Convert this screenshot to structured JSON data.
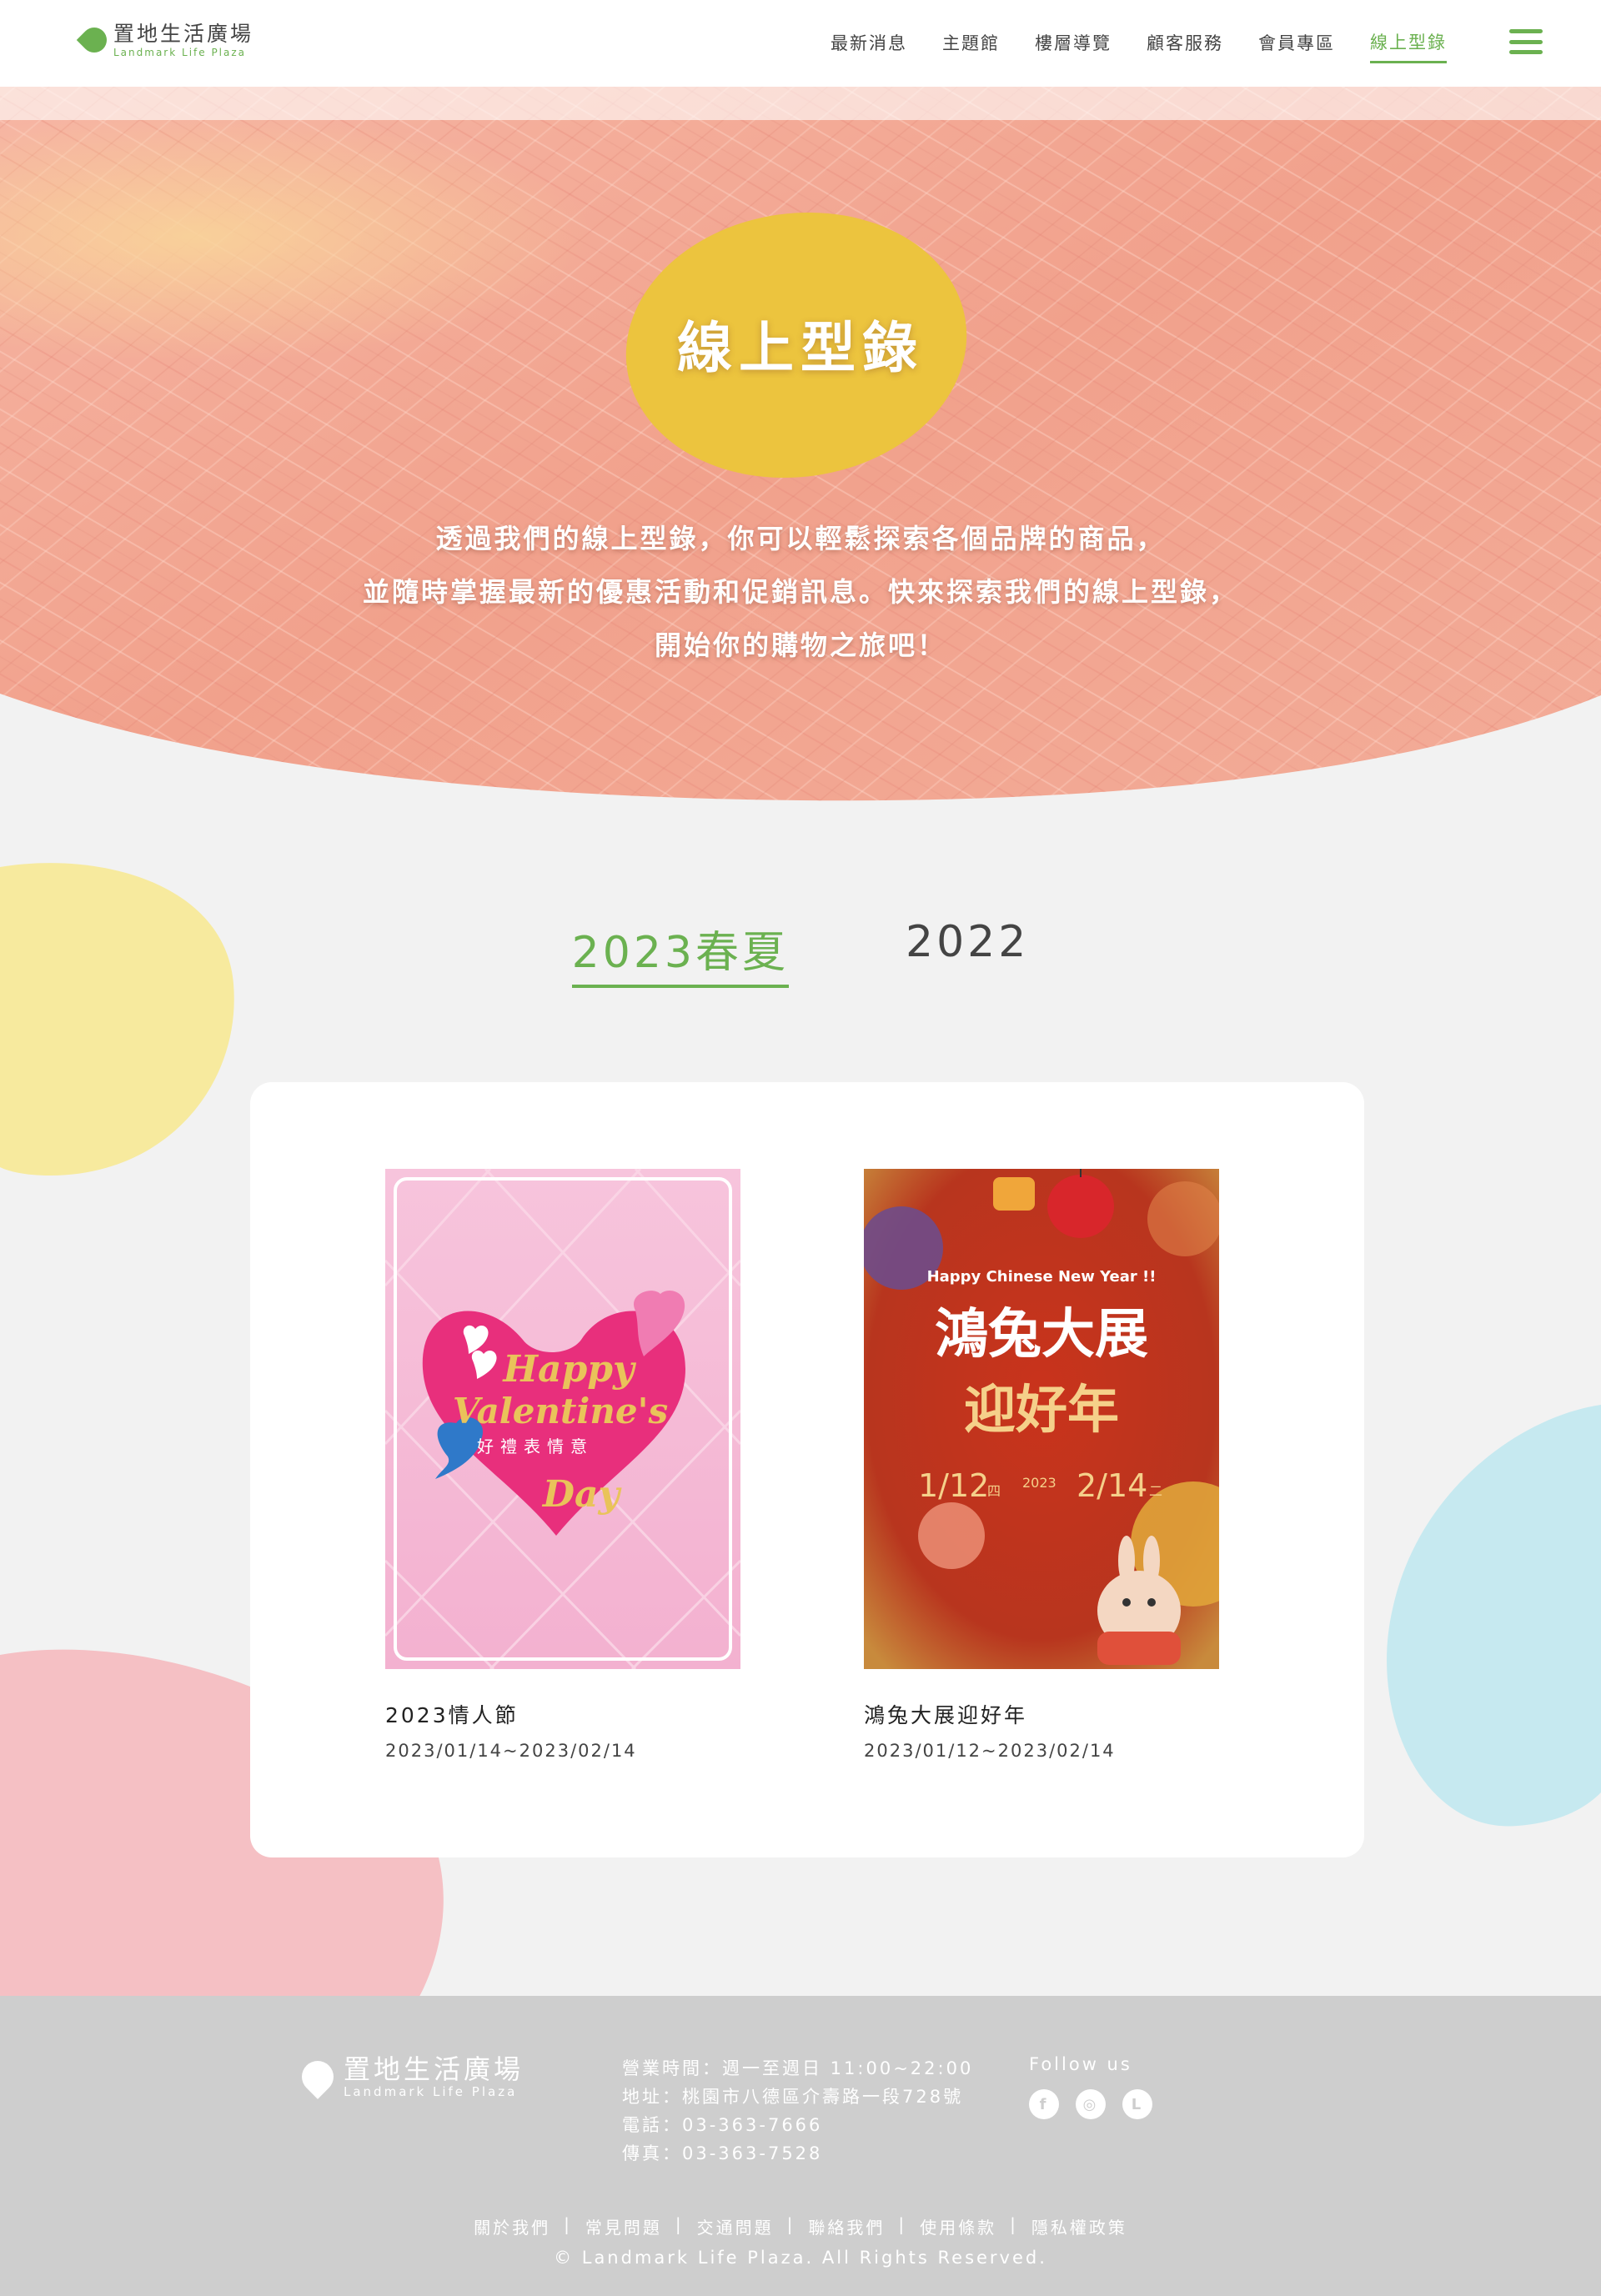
{
  "header": {
    "logo_name": "置地生活廣場",
    "logo_sub": "Landmark Life Plaza",
    "nav": [
      {
        "label": "最新消息"
      },
      {
        "label": "主題館"
      },
      {
        "label": "樓層導覽"
      },
      {
        "label": "顧客服務"
      },
      {
        "label": "會員專區"
      },
      {
        "label": "線上型錄",
        "active": true
      }
    ]
  },
  "hero": {
    "title": "線上型錄",
    "lines": [
      "透過我們的線上型錄，你可以輕鬆探索各個品牌的商品，",
      "並隨時掌握最新的優惠活動和促銷訊息。快來探索我們的線上型錄，",
      "開始你的購物之旅吧！"
    ]
  },
  "tabs": [
    {
      "label": "2023春夏",
      "active": true
    },
    {
      "label": "2022",
      "active": false
    }
  ],
  "catalogs": [
    {
      "title": "2023情人節",
      "date": "2023/01/14~2023/02/14",
      "poster": {
        "line1": "Happy",
        "line2": "Valentine's",
        "line3": "Day",
        "subtitle": "好禮表情意"
      }
    },
    {
      "title": "鴻兔大展迎好年",
      "date": "2023/01/12~2023/02/14",
      "poster": {
        "greeting": "Happy Chinese New Year !!",
        "line1": "鴻兔大展",
        "line2": "迎好年",
        "start": "1/12",
        "start_day": "四",
        "year": "2023",
        "end": "2/14",
        "end_day": "二"
      }
    }
  ],
  "footer": {
    "logo_name": "置地生活廣場",
    "logo_sub": "Landmark Life Plaza",
    "hours": "營業時間：週一至週日 11:00~22:00",
    "address": "地址：桃園市八德區介壽路一段728號",
    "phone": "電話：03-363-7666",
    "fax": "傳真：03-363-7528",
    "follow": "Follow us",
    "socials": [
      {
        "icon": "facebook-icon",
        "glyph": "f"
      },
      {
        "icon": "instagram-icon",
        "glyph": "◎"
      },
      {
        "icon": "line-icon",
        "glyph": "L"
      }
    ],
    "links": [
      "關於我們",
      "常見問題",
      "交通問題",
      "聯絡我們",
      "使用條款",
      "隱私權政策"
    ],
    "copyright": "© Landmark Life Plaza. All Rights Reserved."
  },
  "colors": {
    "accent": "#6bb150",
    "hero_pink": "#f2a48f",
    "hero_blob": "#ecc43e",
    "blob_yellow": "#f7ea9e",
    "blob_pink": "#f5c0c4",
    "blob_blue": "#c6e9f0",
    "footer_bg": "#cecece"
  }
}
